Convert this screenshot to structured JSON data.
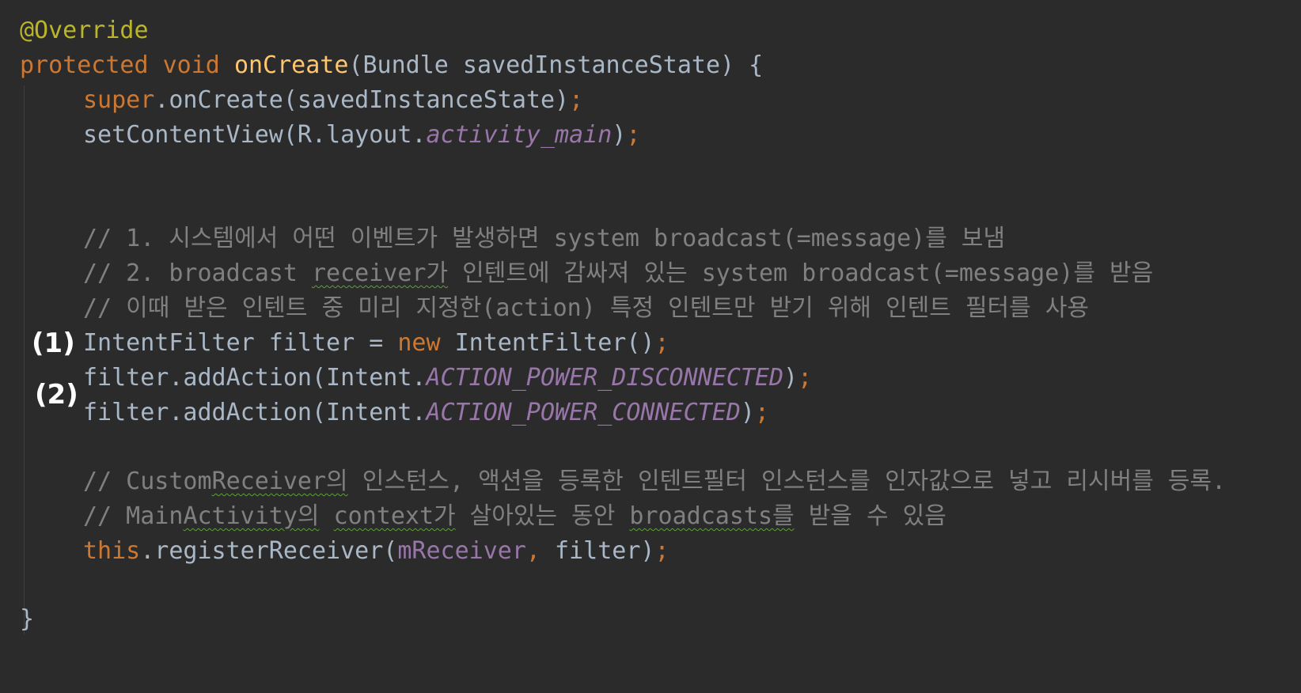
{
  "lines": {
    "l01": {
      "a": "@Override"
    },
    "l02": {
      "a": "protected",
      "b": " ",
      "c": "void",
      "d": " ",
      "e": "onCreate",
      "f": "(Bundle savedInstanceState) {"
    },
    "l03": {
      "a": "super",
      "b": ".onCreate(savedInstanceState)",
      "c": ";"
    },
    "l04": {
      "a": "setContentView(R.layout.",
      "b": "activity_main",
      "c": ")",
      "d": ";"
    },
    "l05": {
      "a": "// 1. 시스템에서 어떤 이벤트가 발생하면 system broadcast(=message)를 보냄"
    },
    "l06": {
      "a": "// 2. broadcast ",
      "b": "receiver가",
      "c": " 인텐트에 감싸져 있는 system broadcast(=message)를 받음"
    },
    "l07": {
      "a": "// 이때 받은 인텐트 중 미리 지정한(action) 특정 인텐트만 받기 위해 인텐트 필터를 사용"
    },
    "l08": {
      "a": "IntentFilter filter = ",
      "b": "new",
      "c": " IntentFilter()",
      "d": ";"
    },
    "l09": {
      "a": "filter.addAction(Intent.",
      "b": "ACTION_POWER_DISCONNECTED",
      "c": ")",
      "d": ";"
    },
    "l10": {
      "a": "filter.addAction(Intent.",
      "b": "ACTION_POWER_CONNECTED",
      "c": ")",
      "d": ";"
    },
    "l11": {
      "a": "// Custom",
      "b": "Receiver의",
      "c": " 인스턴스, 액션을 등록한 인텐트필터 인스턴스를 인자값으로 넣고 리시버를 등록."
    },
    "l12": {
      "a": "// Main",
      "b": "Activity의",
      "c": " ",
      "d": "context가",
      "e": " 살아있는 동안 ",
      "f": "broadcasts를",
      "g": " 받을 수 있음"
    },
    "l13": {
      "a": "this",
      "b": ".registerReceiver(",
      "c": "mReceiver",
      "d": ", ",
      "e": "filter)",
      "f": ";"
    },
    "l14": {
      "a": "}"
    }
  },
  "annotations": {
    "label_1": "(1)",
    "label_2": "(2)"
  },
  "colors": {
    "background": "#2b2b2b",
    "keyword": "#cc7832",
    "annotation": "#bbb529",
    "method_declaration": "#ffc66d",
    "default_text": "#a9b7c6",
    "constant_field": "#9876aa",
    "comment": "#808080",
    "typo_underline": "#5f9e3a"
  }
}
